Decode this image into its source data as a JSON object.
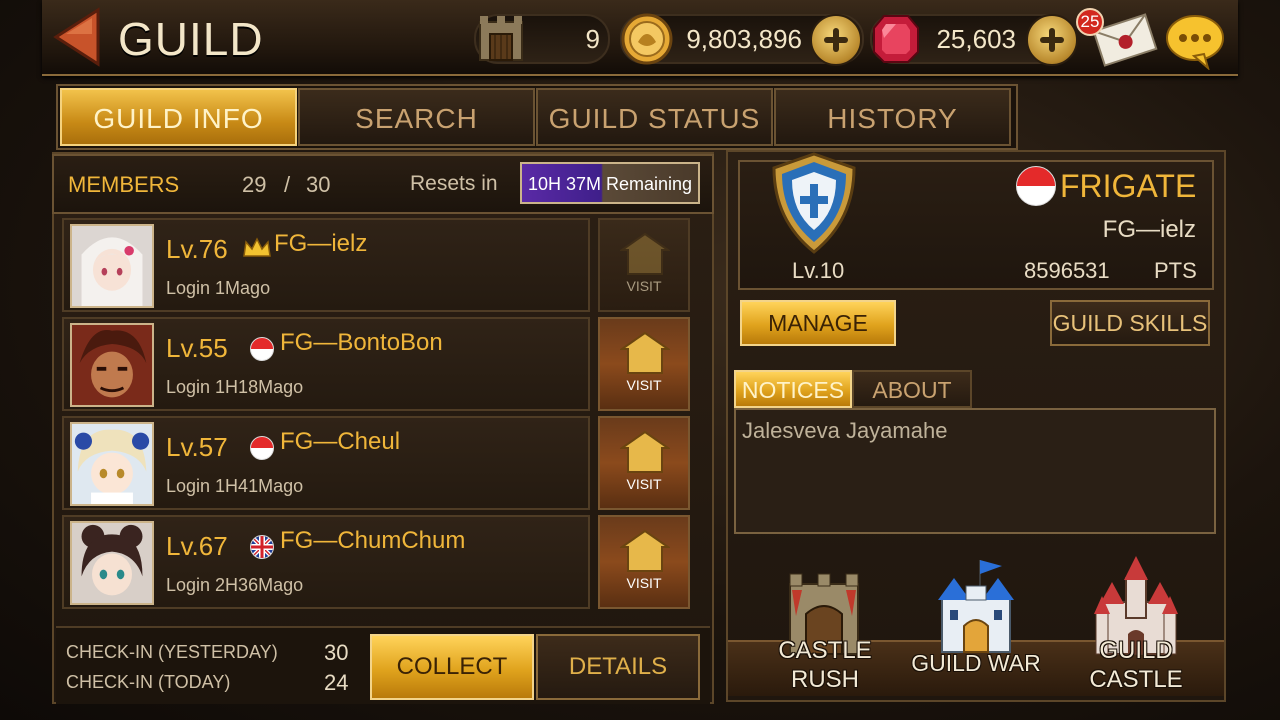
{
  "header": {
    "title": "GUILD",
    "castle_count": "9",
    "gold": "9,803,896",
    "gems": "25,603",
    "mail_badge": "25"
  },
  "tabs": [
    {
      "label": "GUILD INFO",
      "active": true
    },
    {
      "label": "SEARCH"
    },
    {
      "label": "GUILD STATUS"
    },
    {
      "label": "HISTORY"
    }
  ],
  "members_bar": {
    "label": "MEMBERS",
    "count": "29",
    "sep": "/",
    "max": "30",
    "resets_label": "Resets in",
    "timer": "10H 37M",
    "timer_suffix": "Remaining"
  },
  "members": [
    {
      "level": "Lv.76",
      "name": "FG—ielz",
      "login": "Login 1Mago",
      "badge": "crown-icon",
      "visit": "VISIT"
    },
    {
      "level": "Lv.55",
      "name": "FG—BontoBon",
      "login": "Login 1H18Mago",
      "badge": "indonesia-flag-icon",
      "visit": "VISIT"
    },
    {
      "level": "Lv.57",
      "name": "FG—Cheul",
      "login": "Login 1H41Mago",
      "badge": "indonesia-flag-icon",
      "visit": "VISIT"
    },
    {
      "level": "Lv.67",
      "name": "FG—ChumChum",
      "login": "Login 2H36Mago",
      "badge": "uk-flag-icon",
      "visit": "VISIT"
    }
  ],
  "checkin": {
    "yesterday_label": "CHECK-IN (YESTERDAY)",
    "yesterday_value": "30",
    "today_label": "CHECK-IN (TODAY)",
    "today_value": "24",
    "collect": "COLLECT",
    "details": "DETAILS"
  },
  "guild": {
    "name": "FRIGATE",
    "leader": "FG—ielz",
    "level": "Lv.10",
    "points": "8596531",
    "points_unit": "PTS",
    "manage": "MANAGE",
    "skills": "GUILD SKILLS"
  },
  "notices": {
    "tab_notices": "NOTICES",
    "tab_about": "ABOUT",
    "text": "Jalesveva Jayamahe"
  },
  "bottom_nav": [
    {
      "line1": "CASTLE",
      "line2": "RUSH"
    },
    {
      "line1": "GUILD WAR",
      "line2": ""
    },
    {
      "line1": "GUILD",
      "line2": "CASTLE"
    }
  ],
  "colors": {
    "accent": "#f0b63a",
    "gold_button": "#e0a31d",
    "panel": "#241a10"
  }
}
